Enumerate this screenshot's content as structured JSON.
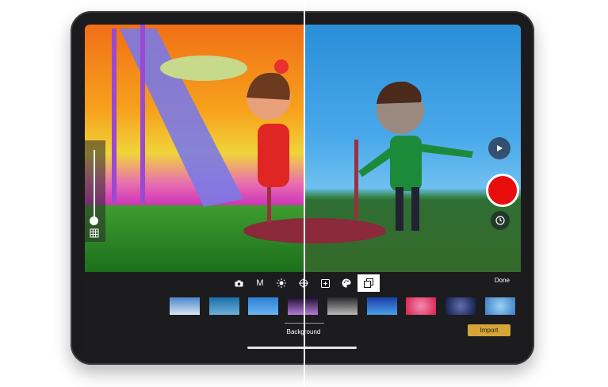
{
  "toolbar": {
    "tools": [
      {
        "icon": "camera-icon",
        "label": ""
      },
      {
        "icon": "manual-icon",
        "label": "M"
      },
      {
        "icon": "brightness-icon",
        "label": ""
      },
      {
        "icon": "focus-icon",
        "label": ""
      },
      {
        "icon": "exposure-icon",
        "label": ""
      },
      {
        "icon": "palette-icon",
        "label": ""
      },
      {
        "icon": "layers-icon",
        "label": ""
      }
    ],
    "done_label": "Done",
    "background_label": "Background",
    "import_label": "Import"
  },
  "thumbnails": [
    {
      "name": "clouds",
      "colors": [
        "#4a85c9",
        "#d8e6f5"
      ]
    },
    {
      "name": "sea",
      "colors": [
        "#1b6ea8",
        "#6fb1d8"
      ]
    },
    {
      "name": "sky",
      "colors": [
        "#2e7fd8",
        "#69b6f0"
      ]
    },
    {
      "name": "nebula",
      "colors": [
        "#1a1030",
        "#b77ad6"
      ]
    },
    {
      "name": "moon",
      "colors": [
        "#2a2a2a",
        "#b8b8b8"
      ]
    },
    {
      "name": "gradient-blue",
      "colors": [
        "#1a3fa8",
        "#4aa0e8"
      ]
    },
    {
      "name": "pink",
      "colors": [
        "#d8204e",
        "#f28ab0"
      ]
    },
    {
      "name": "space",
      "colors": [
        "#0f1a44",
        "#5f6fb0"
      ]
    },
    {
      "name": "water",
      "colors": [
        "#3a7ec8",
        "#9bd0f0"
      ]
    }
  ],
  "colors": {
    "record": "#e80d0d",
    "import": "#d7a437"
  }
}
